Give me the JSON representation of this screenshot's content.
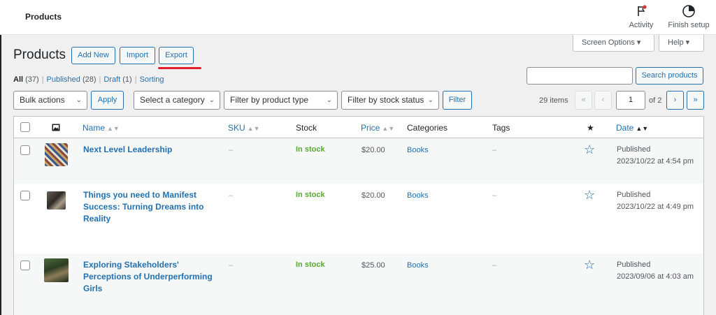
{
  "topbar": {
    "title": "Products",
    "activity_label": "Activity",
    "finish_setup_label": "Finish setup"
  },
  "screen_options": {
    "screen_options_label": "Screen Options ▾",
    "help_label": "Help ▾"
  },
  "header": {
    "title": "Products",
    "add_new_label": "Add New",
    "import_label": "Import",
    "export_label": "Export"
  },
  "views": {
    "all_label": "All",
    "all_count": "(37)",
    "published_label": "Published",
    "published_count": "(28)",
    "draft_label": "Draft",
    "draft_count": "(1)",
    "sorting_label": "Sorting"
  },
  "search": {
    "value": "",
    "button_label": "Search products"
  },
  "filters": {
    "bulk_actions": "Bulk actions",
    "apply_label": "Apply",
    "category": "Select a category",
    "product_type": "Filter by product type",
    "stock_status": "Filter by stock status",
    "filter_label": "Filter"
  },
  "pagination": {
    "items": "29 items",
    "first": "«",
    "prev": "‹",
    "current_page": "1",
    "of_pages": "of 2",
    "next": "›",
    "last": "»"
  },
  "columns": {
    "name": "Name",
    "sku": "SKU",
    "stock": "Stock",
    "price": "Price",
    "categories": "Categories",
    "tags": "Tags",
    "featured": "★",
    "date": "Date"
  },
  "rows": [
    {
      "name_line1": "Next Level Leadership",
      "name_line2": "",
      "name_line3": "",
      "sku": "–",
      "stock": "In stock",
      "price": "$20.00",
      "category": "Books",
      "tags": "–",
      "status": "Published",
      "date": "2023/10/22 at 4:54 pm"
    },
    {
      "name_line1": "Things you need to Manifest",
      "name_line2": "Success: Turning Dreams into",
      "name_line3": "Reality",
      "sku": "–",
      "stock": "In stock",
      "price": "$20.00",
      "category": "Books",
      "tags": "–",
      "status": "Published",
      "date": "2023/10/22 at 4:49 pm"
    },
    {
      "name_line1": "Exploring Stakeholders'",
      "name_line2": "Perceptions of Underperforming",
      "name_line3": "Girls",
      "sku": "–",
      "stock": "In stock",
      "price": "$25.00",
      "category": "Books",
      "tags": "–",
      "status": "Published",
      "date": "2023/09/06 at 4:03 am"
    }
  ],
  "colors": {
    "accent": "#2271b1",
    "in_stock": "#59a832",
    "highlight_underline": "#e0202a"
  }
}
